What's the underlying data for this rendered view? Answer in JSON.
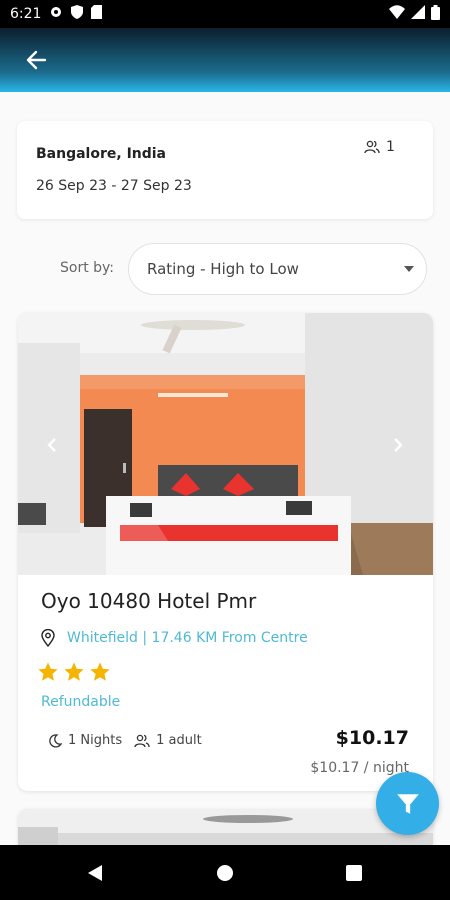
{
  "status_bar": {
    "time": "6:21",
    "icons": [
      "gear-icon",
      "shield-icon",
      "sd-card-icon",
      "wifi-icon",
      "signal-icon",
      "battery-icon"
    ]
  },
  "app_bar": {
    "back_icon": "arrow-left-icon"
  },
  "search": {
    "city": "Bangalore, India",
    "dates": "26 Sep 23 - 27 Sep 23",
    "guests": "1"
  },
  "sort": {
    "label": "Sort by:",
    "value": "Rating - High to Low"
  },
  "hotel": {
    "name": "Oyo 10480 Hotel Pmr",
    "location": "Whitefield | 17.46 KM From Centre",
    "rating": 3,
    "refund": "Refundable",
    "nights": "1 Nights",
    "adults": "1 adult",
    "price": "$10.17",
    "per_night": "$10.17 / night"
  },
  "colors": {
    "accent": "#33aee6",
    "link": "#4fb9d6",
    "star": "#f5b400"
  }
}
